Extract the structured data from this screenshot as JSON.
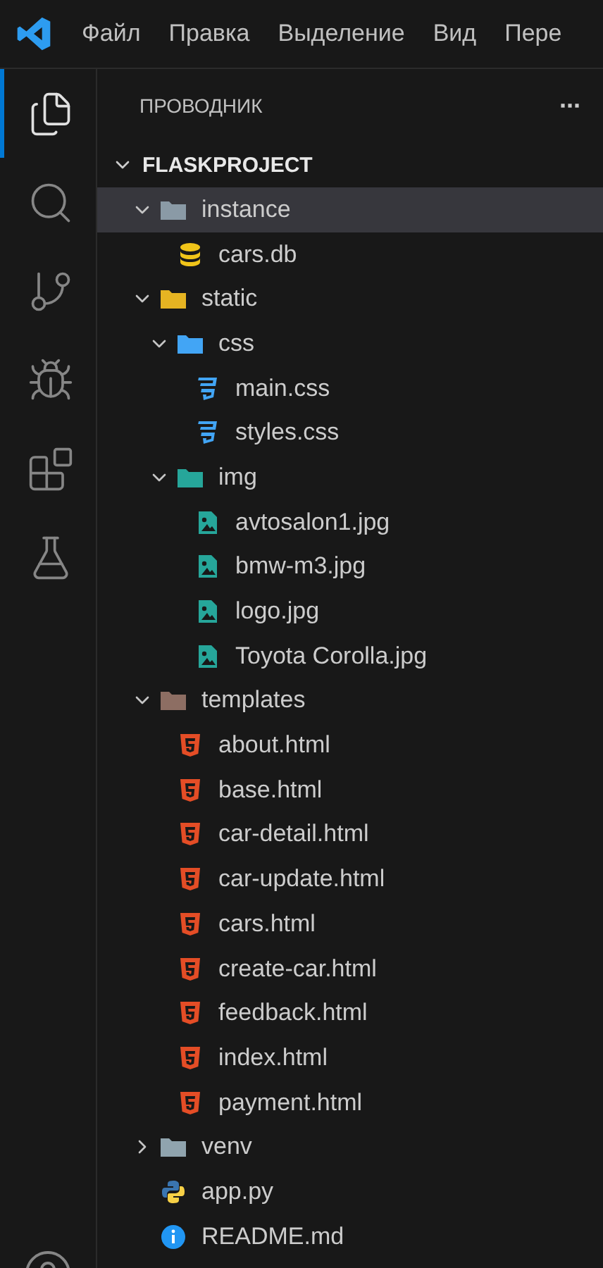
{
  "menu": {
    "items": [
      "Файл",
      "Правка",
      "Выделение",
      "Вид",
      "Пере"
    ]
  },
  "activity_bar": {
    "items": [
      {
        "kind": "explorer",
        "selected": true
      },
      {
        "kind": "search",
        "selected": false
      },
      {
        "kind": "source-control",
        "selected": false
      },
      {
        "kind": "run-debug",
        "selected": false
      },
      {
        "kind": "extensions",
        "selected": false
      },
      {
        "kind": "testing",
        "selected": false
      }
    ]
  },
  "explorer": {
    "title": "ПРОВОДНИК",
    "more": "···",
    "project": {
      "name": "FLASKPROJECT",
      "expanded": true
    },
    "tree": [
      {
        "kind": "folder",
        "name": "instance",
        "color": "#8a9aa6",
        "expanded": true,
        "selected": true,
        "children": [
          {
            "kind": "db",
            "name": "cars.db",
            "selected": false
          }
        ]
      },
      {
        "kind": "folder",
        "name": "static",
        "color": "#e6b422",
        "expanded": true,
        "selected": false,
        "children": [
          {
            "kind": "folder",
            "name": "css",
            "color": "#42a5f5",
            "expanded": true,
            "selected": false,
            "children": [
              {
                "kind": "css",
                "name": "main.css",
                "selected": false
              },
              {
                "kind": "css",
                "name": "styles.css",
                "selected": false
              }
            ]
          },
          {
            "kind": "folder",
            "name": "img",
            "color": "#26a69a",
            "expanded": true,
            "selected": false,
            "children": [
              {
                "kind": "image",
                "name": "avtosalon1.jpg",
                "selected": false
              },
              {
                "kind": "image",
                "name": "bmw-m3.jpg",
                "selected": false
              },
              {
                "kind": "image",
                "name": "logo.jpg",
                "selected": false
              },
              {
                "kind": "image",
                "name": "Toyota Corolla.jpg",
                "selected": false
              }
            ]
          }
        ]
      },
      {
        "kind": "folder",
        "name": "templates",
        "color": "#8d6e63",
        "expanded": true,
        "selected": false,
        "children": [
          {
            "kind": "html",
            "name": "about.html",
            "selected": false
          },
          {
            "kind": "html",
            "name": "base.html",
            "selected": false
          },
          {
            "kind": "html",
            "name": "car-detail.html",
            "selected": false
          },
          {
            "kind": "html",
            "name": "car-update.html",
            "selected": false
          },
          {
            "kind": "html",
            "name": "cars.html",
            "selected": false
          },
          {
            "kind": "html",
            "name": "create-car.html",
            "selected": false
          },
          {
            "kind": "html",
            "name": "feedback.html",
            "selected": false
          },
          {
            "kind": "html",
            "name": "index.html",
            "selected": false
          },
          {
            "kind": "html",
            "name": "payment.html",
            "selected": false
          }
        ]
      },
      {
        "kind": "folder",
        "name": "venv",
        "color": "#90a4ae",
        "expanded": false,
        "selected": false
      },
      {
        "kind": "python",
        "name": "app.py",
        "selected": false
      },
      {
        "kind": "info",
        "name": "README.md",
        "selected": false
      }
    ]
  }
}
